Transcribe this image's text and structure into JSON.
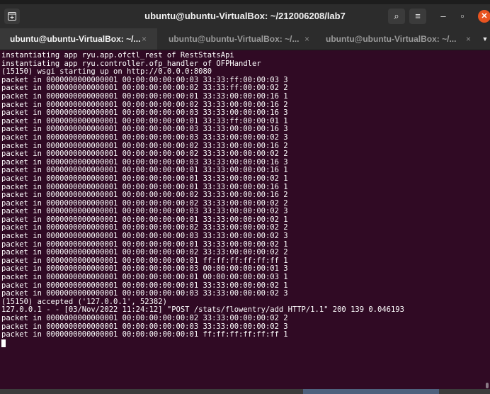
{
  "window": {
    "title": "ubuntu@ubuntu-VirtualBox: ~/212006208/lab7",
    "new_tab_icon": "terminal-plus-icon",
    "search_icon_glyph": "⌕",
    "menu_icon_glyph": "≡",
    "minimize_glyph": "–",
    "maximize_glyph": "▫",
    "close_glyph": "✕",
    "close_color": "#e95420"
  },
  "tabs": [
    {
      "label": "ubuntu@ubuntu-VirtualBox: ~/...",
      "close": "×",
      "active": true
    },
    {
      "label": "ubuntu@ubuntu-VirtualBox: ~/...",
      "close": "×",
      "active": false
    },
    {
      "label": "ubuntu@ubuntu-VirtualBox: ~/...",
      "close": "×",
      "active": false
    }
  ],
  "tab_menu_glyph": "▼",
  "terminal": {
    "background": "#300a24",
    "lines": [
      "instantiating app ryu.app.ofctl_rest of RestStatsApi",
      "instantiating app ryu.controller.ofp_handler of OFPHandler",
      "(15150) wsgi starting up on http://0.0.0.0:8080",
      "packet in 0000000000000001 00:00:00:00:00:03 33:33:ff:00:00:03 3",
      "packet in 0000000000000001 00:00:00:00:00:02 33:33:ff:00:00:02 2",
      "packet in 0000000000000001 00:00:00:00:00:01 33:33:00:00:00:16 1",
      "packet in 0000000000000001 00:00:00:00:00:02 33:33:00:00:00:16 2",
      "packet in 0000000000000001 00:00:00:00:00:03 33:33:00:00:00:16 3",
      "packet in 0000000000000001 00:00:00:00:00:01 33:33:ff:00:00:01 1",
      "packet in 0000000000000001 00:00:00:00:00:03 33:33:00:00:00:16 3",
      "packet in 0000000000000001 00:00:00:00:00:03 33:33:00:00:00:02 3",
      "packet in 0000000000000001 00:00:00:00:00:02 33:33:00:00:00:16 2",
      "packet in 0000000000000001 00:00:00:00:00:02 33:33:00:00:00:02 2",
      "packet in 0000000000000001 00:00:00:00:00:03 33:33:00:00:00:16 3",
      "packet in 0000000000000001 00:00:00:00:00:01 33:33:00:00:00:16 1",
      "packet in 0000000000000001 00:00:00:00:00:01 33:33:00:00:00:02 1",
      "packet in 0000000000000001 00:00:00:00:00:01 33:33:00:00:00:16 1",
      "packet in 0000000000000001 00:00:00:00:00:02 33:33:00:00:00:16 2",
      "packet in 0000000000000001 00:00:00:00:00:02 33:33:00:00:00:02 2",
      "packet in 0000000000000001 00:00:00:00:00:03 33:33:00:00:00:02 3",
      "packet in 0000000000000001 00:00:00:00:00:01 33:33:00:00:00:02 1",
      "packet in 0000000000000001 00:00:00:00:00:02 33:33:00:00:00:02 2",
      "packet in 0000000000000001 00:00:00:00:00:03 33:33:00:00:00:02 3",
      "packet in 0000000000000001 00:00:00:00:00:01 33:33:00:00:00:02 1",
      "packet in 0000000000000001 00:00:00:00:00:02 33:33:00:00:00:02 2",
      "packet in 0000000000000001 00:00:00:00:00:01 ff:ff:ff:ff:ff:ff 1",
      "packet in 0000000000000001 00:00:00:00:00:03 00:00:00:00:00:01 3",
      "packet in 0000000000000001 00:00:00:00:00:01 00:00:00:00:00:03 1",
      "packet in 0000000000000001 00:00:00:00:00:01 33:33:00:00:00:02 1",
      "packet in 0000000000000001 00:00:00:00:00:03 33:33:00:00:00:02 3",
      "(15150) accepted ('127.0.0.1', 52382)",
      "127.0.0.1 - - [03/Nov/2022 11:24:12] \"POST /stats/flowentry/add HTTP/1.1\" 200 139 0.046193",
      "packet in 0000000000000001 00:00:00:00:00:02 33:33:00:00:00:02 2",
      "packet in 0000000000000001 00:00:00:00:00:03 33:33:00:00:00:02 3",
      "packet in 0000000000000001 00:00:00:00:00:01 ff:ff:ff:ff:ff:ff 1"
    ]
  }
}
